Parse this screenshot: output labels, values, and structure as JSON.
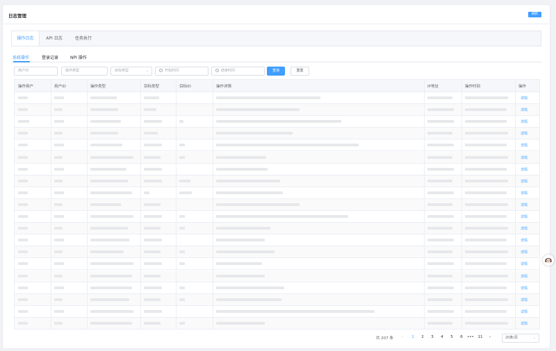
{
  "header": {
    "title": "日志管理",
    "refresh_label": "刷新"
  },
  "tabs": [
    {
      "label": "操作日志"
    },
    {
      "label": "API 日志"
    },
    {
      "label": "任务执行"
    }
  ],
  "subtabs": [
    {
      "label": "系统操作"
    },
    {
      "label": "登录记录"
    },
    {
      "label": "NPI 操作"
    }
  ],
  "filters": {
    "user_id_placeholder": "用户ID",
    "op_type_placeholder": "操作类型",
    "target_type_placeholder": "目标类型",
    "start_time_placeholder": "开始时间",
    "end_time_placeholder": "结束时间",
    "query_label": "查询",
    "reset_label": "重置"
  },
  "table": {
    "columns": [
      "操作用户",
      "用户ID",
      "操作类型",
      "目标类型",
      "目标ID",
      "操作详情",
      "IP地址",
      "操作时间",
      "操作"
    ],
    "row_action_label": "详情",
    "row_count": 20
  },
  "pagination": {
    "total_label": "共 207 条",
    "pages": [
      "1",
      "2",
      "3",
      "4",
      "5",
      "6",
      "•••",
      "11"
    ],
    "prev_icon": "‹",
    "next_icon": "›",
    "page_size_label": "20条/页"
  },
  "colors": {
    "accent": "#409eff",
    "border": "#ebeef5",
    "header_bg": "#f5f7fa"
  }
}
